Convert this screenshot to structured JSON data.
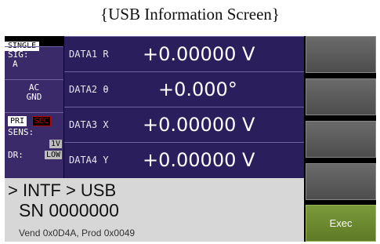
{
  "caption": "{USB Information Screen}",
  "status": {
    "mode": "SINGLE",
    "sig_label": "SIG:",
    "sig_value": "A",
    "coupling_1": "AC",
    "coupling_2": "GND",
    "pri": "PRI",
    "sec": "SEC",
    "sens_label": "SENS:",
    "sens_value": "1V",
    "dr_label": "DR:",
    "dr_value": "LOW"
  },
  "rows": [
    {
      "label": "DATA1  R",
      "value": "+0.00000  V"
    },
    {
      "label": "DATA2  θ",
      "value": "+0.000°"
    },
    {
      "label": "DATA3  X",
      "value": "+0.00000  V"
    },
    {
      "label": "DATA4  Y",
      "value": "+0.00000  V"
    }
  ],
  "info": {
    "path": "> INTF > USB",
    "sn": "SN 0000000",
    "vend": "Vend 0x0D4A, Prod 0x0049"
  },
  "softkeys": {
    "exec_label": "Exec"
  }
}
